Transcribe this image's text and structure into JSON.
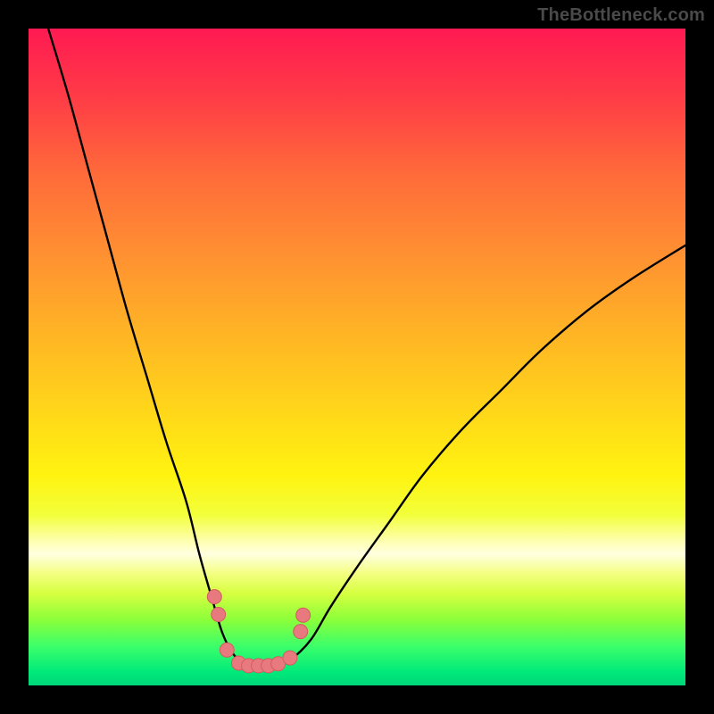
{
  "watermark": "TheBottleneck.com",
  "colors": {
    "background": "#000000",
    "gradient_top": "#ff1a52",
    "gradient_mid": "#ffd61a",
    "gradient_bottom": "#00d67a",
    "curve_stroke": "#000000",
    "marker_fill": "#e87a7f",
    "marker_stroke": "#d25c60"
  },
  "chart_data": {
    "type": "line",
    "title": "",
    "xlabel": "",
    "ylabel": "",
    "xlim": [
      0,
      100
    ],
    "ylim": [
      0,
      100
    ],
    "curve": {
      "x": [
        3,
        6,
        9,
        12,
        15,
        18,
        21,
        24,
        26,
        28,
        29.5,
        31,
        32.5,
        34,
        36,
        38,
        40,
        43,
        46,
        50,
        55,
        60,
        66,
        72,
        78,
        85,
        92,
        100
      ],
      "values": [
        100,
        90,
        79,
        68,
        57,
        47,
        37,
        28,
        20,
        13,
        8,
        5,
        3.5,
        3,
        3,
        3,
        4,
        7,
        12,
        18,
        25,
        32,
        39,
        45,
        51,
        57,
        62,
        67
      ]
    },
    "markers": [
      {
        "x": 28.3,
        "y": 13.5
      },
      {
        "x": 28.9,
        "y": 10.8
      },
      {
        "x": 30.2,
        "y": 5.4
      },
      {
        "x": 32.0,
        "y": 3.4
      },
      {
        "x": 33.5,
        "y": 3.0
      },
      {
        "x": 35.0,
        "y": 3.0
      },
      {
        "x": 36.5,
        "y": 3.0
      },
      {
        "x": 38.0,
        "y": 3.3
      },
      {
        "x": 39.8,
        "y": 4.2
      },
      {
        "x": 41.4,
        "y": 8.2
      },
      {
        "x": 41.8,
        "y": 10.7
      }
    ]
  }
}
